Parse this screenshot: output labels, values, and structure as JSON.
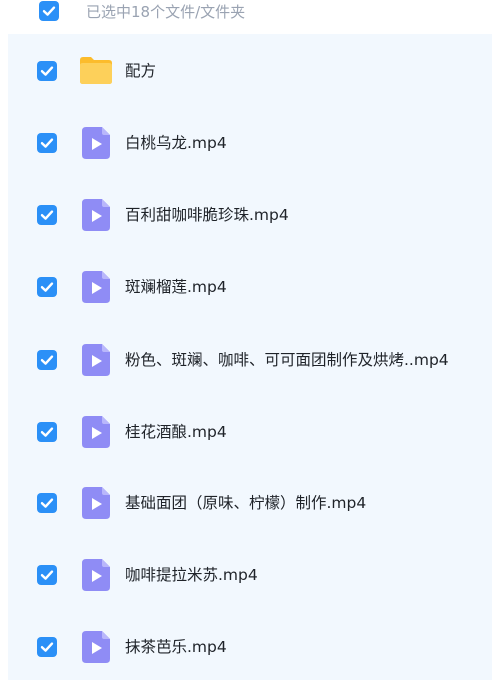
{
  "header": {
    "selection_label": "已选中18个文件/文件夹"
  },
  "files": [
    {
      "name": "配方",
      "type": "folder",
      "icon": "folder-icon",
      "checked": true
    },
    {
      "name": "白桃乌龙.mp4",
      "type": "video",
      "icon": "video-file-icon",
      "checked": true
    },
    {
      "name": "百利甜咖啡脆珍珠.mp4",
      "type": "video",
      "icon": "video-file-icon",
      "checked": true
    },
    {
      "name": "斑斓榴莲.mp4",
      "type": "video",
      "icon": "video-file-icon",
      "checked": true
    },
    {
      "name": "粉色、斑斓、咖啡、可可面团制作及烘烤..mp4",
      "type": "video",
      "icon": "video-file-icon",
      "checked": true
    },
    {
      "name": "桂花酒酿.mp4",
      "type": "video",
      "icon": "video-file-icon",
      "checked": true
    },
    {
      "name": "基础面团（原味、柠檬）制作.mp4",
      "type": "video",
      "icon": "video-file-icon",
      "checked": true
    },
    {
      "name": "咖啡提拉米苏.mp4",
      "type": "video",
      "icon": "video-file-icon",
      "checked": true
    },
    {
      "name": "抹茶芭乐.mp4",
      "type": "video",
      "icon": "video-file-icon",
      "checked": true
    }
  ],
  "colors": {
    "checkbox": "#2b90f7",
    "panel_bg": "#f2f8fe",
    "folder": "#fcbc2c",
    "video_icon": "#8f8cf5",
    "header_text": "#9aa3b2",
    "file_text": "#1f2329"
  }
}
